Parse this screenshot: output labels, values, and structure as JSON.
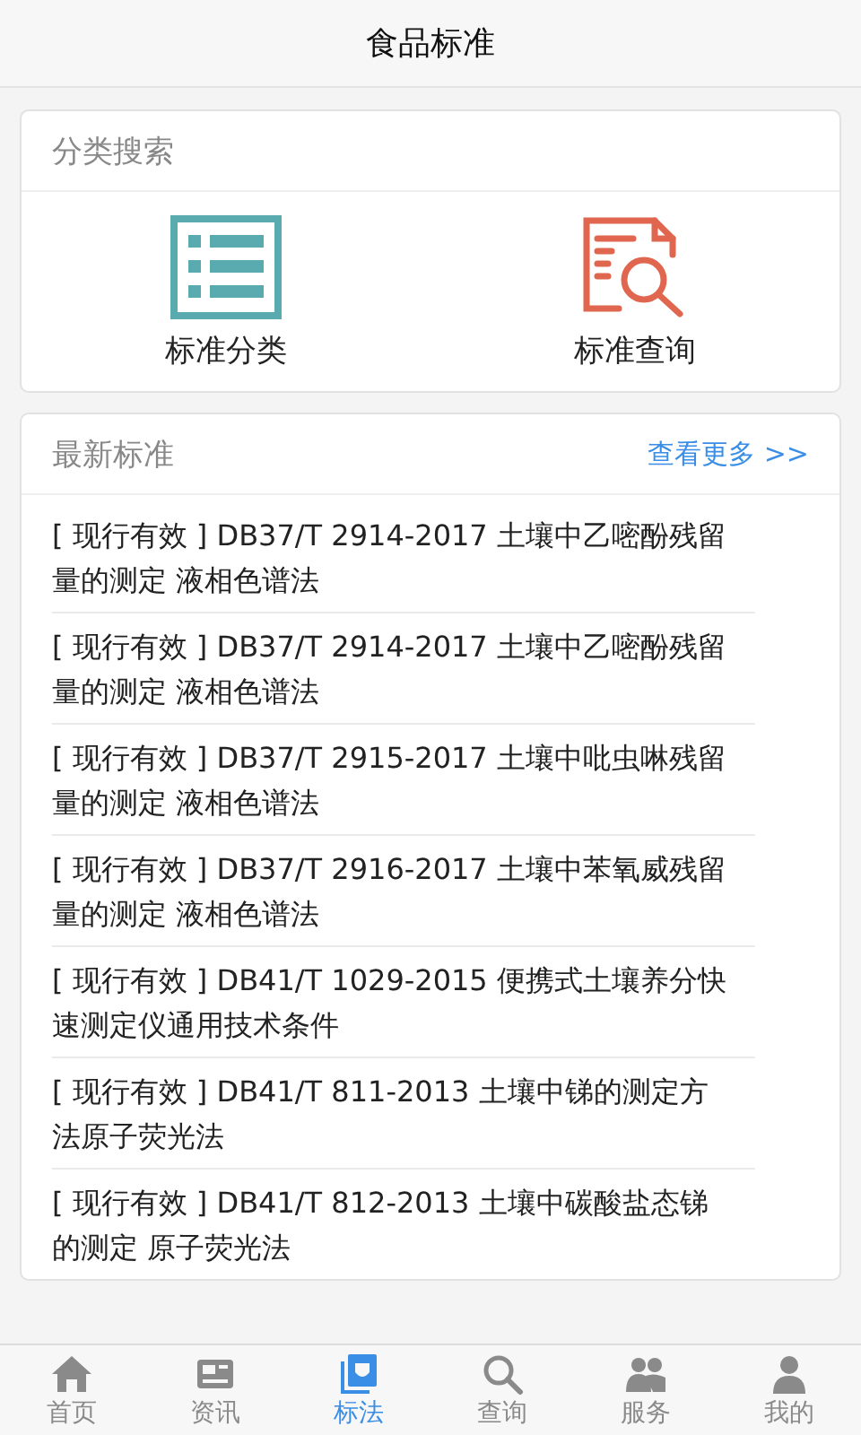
{
  "title": "食品标准",
  "category_card": {
    "heading": "分类搜索",
    "entries": [
      {
        "kind": "list",
        "label": "标准分类"
      },
      {
        "kind": "lookup",
        "label": "标准查询"
      }
    ]
  },
  "latest_card": {
    "heading": "最新标准",
    "more_link": "查看更多 >>",
    "items": [
      {
        "text": "[ 现行有效 ] DB37/T 2914-2017 土壤中乙嘧酚残留量的测定 液相色谱法"
      },
      {
        "text": "[ 现行有效 ] DB37/T 2914-2017 土壤中乙嘧酚残留量的测定 液相色谱法"
      },
      {
        "text": "[ 现行有效 ] DB37/T 2915-2017 土壤中吡虫啉残留量的测定 液相色谱法"
      },
      {
        "text": "[ 现行有效 ] DB37/T 2916-2017 土壤中苯氧威残留量的测定 液相色谱法"
      },
      {
        "text": "[ 现行有效 ] DB41/T 1029-2015 便携式土壤养分快速测定仪通用技术条件"
      },
      {
        "text": "[ 现行有效 ] DB41/T 811-2013 土壤中锑的测定方法原子荧光法"
      },
      {
        "text": "[ 现行有效 ] DB41/T 812-2013 土壤中碳酸盐态锑的测定 原子荧光法"
      }
    ]
  },
  "tabs": [
    {
      "kind": "home",
      "label": "首页",
      "selected": false
    },
    {
      "kind": "news",
      "label": "资讯",
      "selected": false
    },
    {
      "kind": "standard",
      "label": "标法",
      "selected": true
    },
    {
      "kind": "search",
      "label": "查询",
      "selected": false
    },
    {
      "kind": "service",
      "label": "服务",
      "selected": false
    },
    {
      "kind": "profile",
      "label": "我的",
      "selected": false
    }
  ]
}
